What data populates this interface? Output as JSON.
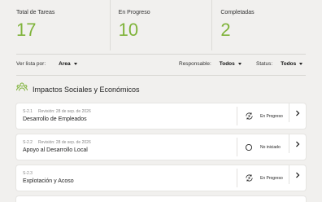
{
  "stats": [
    {
      "label": "Total de Tareas",
      "value": "17"
    },
    {
      "label": "En Progreso",
      "value": "10"
    },
    {
      "label": "Completadas",
      "value": "2"
    }
  ],
  "filters": {
    "view_label": "Ver lista por:",
    "view_value": "Area",
    "responsible_label": "Responsable:",
    "responsible_value": "Todos",
    "status_label": "Status:",
    "status_value": "Todos"
  },
  "section": {
    "title": "Impactos Sociales y Económicos",
    "icon": "people-group-icon"
  },
  "tasks": [
    {
      "code": "S-2.1",
      "review": "Revisión: 28 de sep. de 2026",
      "name": "Desarrollo de Empleados",
      "status": "En Progreso",
      "status_icon": "in-progress-icon"
    },
    {
      "code": "S-2.2",
      "review": "Revisión: 28 de sep. de 2026",
      "name": "Apoyo al Desarrollo Local",
      "status": "No iniciado",
      "status_icon": "not-started-icon"
    },
    {
      "code": "S-2.3",
      "review": "",
      "name": "Explotación y Acoso",
      "status": "En Progreso",
      "status_icon": "in-progress-icon"
    }
  ],
  "colors": {
    "accent": "#7fb33a",
    "background": "#f1f0ee",
    "card": "#ffffff"
  }
}
